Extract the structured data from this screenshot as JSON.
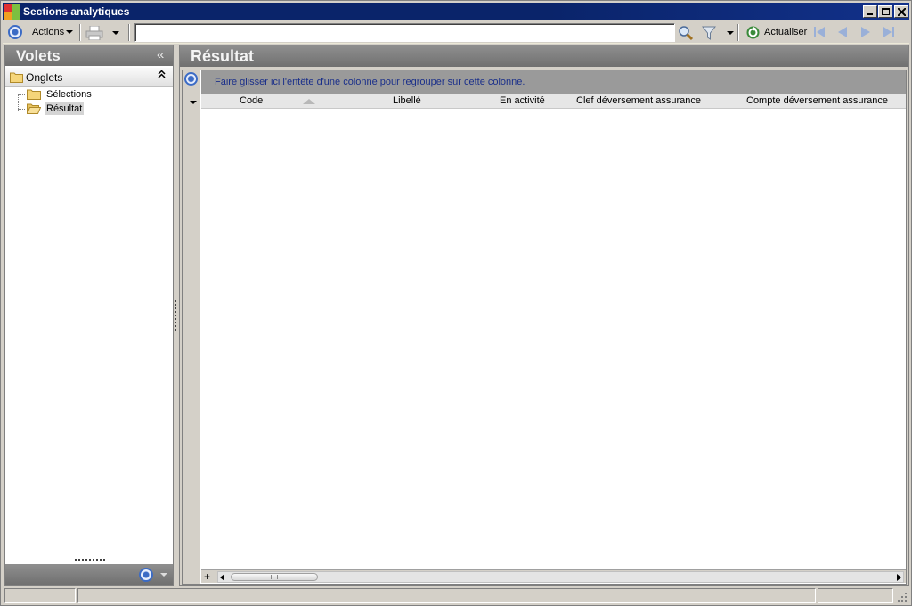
{
  "window": {
    "title": "Sections analytiques",
    "min_label": "",
    "max_label": "",
    "close_label": ""
  },
  "toolbar": {
    "actions_label": "Actions",
    "search_value": "",
    "refresh_label": "Actualiser",
    "icons": [
      "options-icon",
      "print-icon",
      "search-icon",
      "filter-icon",
      "refresh-icon",
      "first-page-icon",
      "previous-page-icon",
      "next-page-icon",
      "last-page-icon"
    ]
  },
  "left_pane": {
    "title": "Volets",
    "collapse_label": "«",
    "group": {
      "label": "Onglets",
      "toggle_label": "⌃"
    },
    "items": [
      {
        "label": "Sélections",
        "selected": false
      },
      {
        "label": "Résultat",
        "selected": true
      }
    ]
  },
  "result_pane": {
    "title": "Résultat",
    "group_hint": "Faire glisser ici l'entête d'une colonne pour regrouper sur cette colonne.",
    "columns": [
      {
        "label": "Code",
        "sorted": "ascending"
      },
      {
        "label": "Libellé"
      },
      {
        "label": "En activité"
      },
      {
        "label": "Clef déversement assurance"
      },
      {
        "label": "Compte déversement assurance"
      }
    ],
    "rows": [],
    "add_label": "+"
  },
  "colors": {
    "title_bar": "#0a246a",
    "pane_header": "#7f7f7f",
    "group_hint_text": "#1a2f8a",
    "accent_blue": "#3b6bc5"
  }
}
